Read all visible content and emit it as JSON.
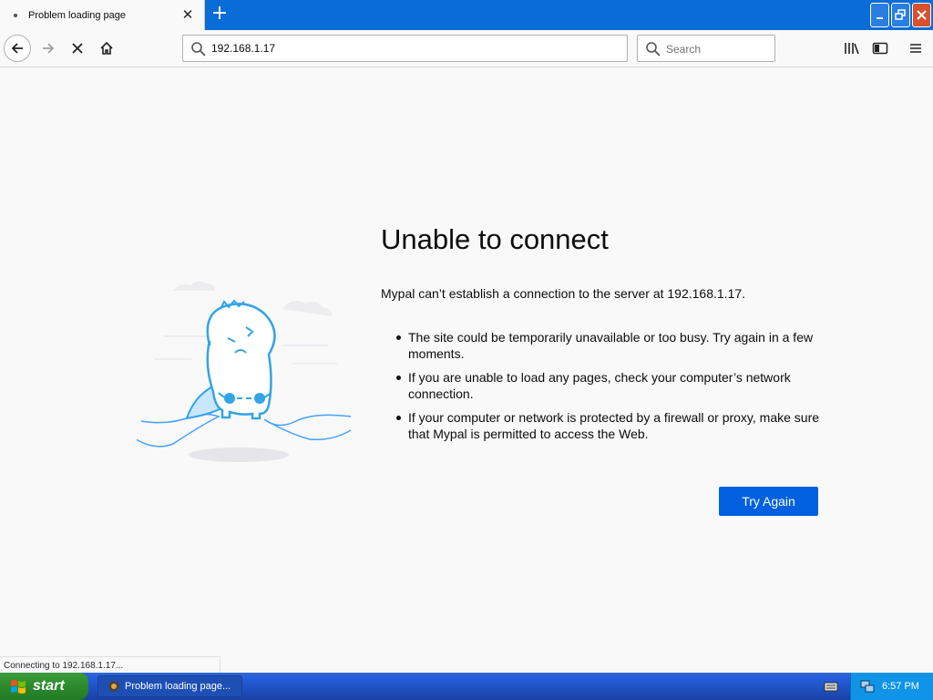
{
  "browser": {
    "tab": {
      "title": "Problem loading page",
      "close_label": "✕"
    },
    "newtab_label": "+",
    "url": "192.168.1.17",
    "search_placeholder": "Search"
  },
  "error": {
    "title": "Unable to connect",
    "description": "Mypal can’t establish a connection to the server at 192.168.1.17.",
    "bullets": [
      "The site could be temporarily unavailable or too busy. Try again in a few moments.",
      "If you are unable to load any pages, check your computer’s network connection.",
      "If your computer or network is protected by a firewall or proxy, make sure that Mypal is permitted to access the Web."
    ],
    "button": "Try Again"
  },
  "status": "Connecting to 192.168.1.17...",
  "taskbar": {
    "start": "start",
    "task_label": "Problem loading page...",
    "clock": "6:57 PM"
  },
  "colors": {
    "accent": "#0060df",
    "titlebar": "#0a6cd6"
  }
}
